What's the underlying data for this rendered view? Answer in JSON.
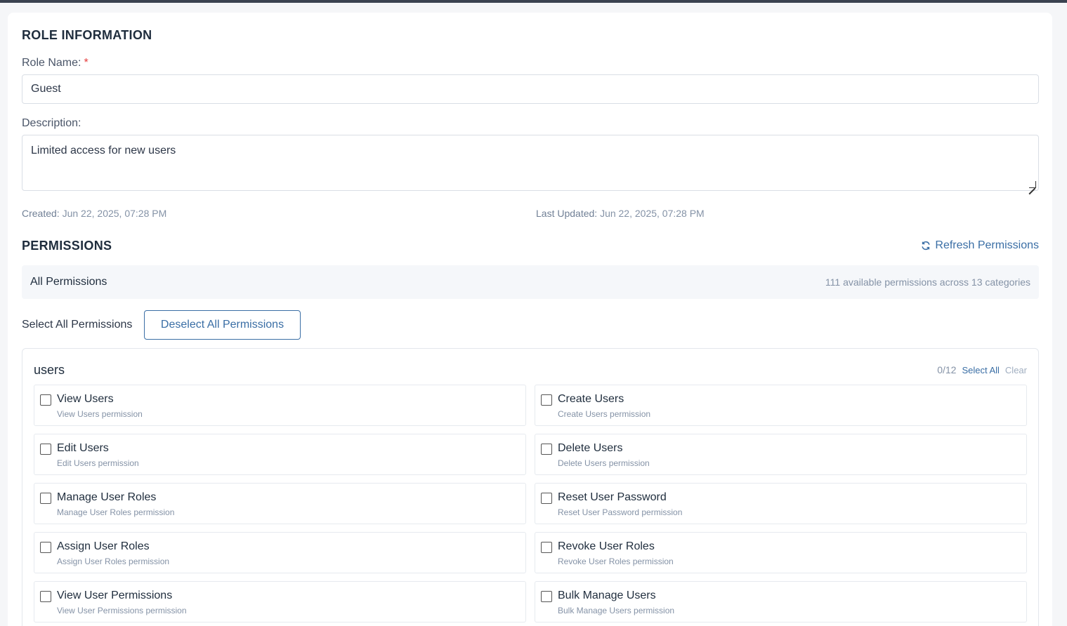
{
  "role_info": {
    "title": "ROLE INFORMATION",
    "name_label": "Role Name:",
    "required_mark": "*",
    "name_value": "Guest",
    "description_label": "Description:",
    "description_value": "Limited access for new users",
    "created_label": "Created:",
    "created_value": "Jun 22, 2025, 07:28 PM",
    "updated_label": "Last Updated:",
    "updated_value": "Jun 22, 2025, 07:28 PM"
  },
  "permissions": {
    "title": "PERMISSIONS",
    "refresh_label": "Refresh Permissions",
    "all_label": "All Permissions",
    "summary": "111 available permissions across 13 categories",
    "select_all_label": "Select All Permissions",
    "deselect_all_label": "Deselect All Permissions",
    "group": {
      "name": "users",
      "count": "0/12",
      "select_all": "Select All",
      "clear": "Clear",
      "items": [
        {
          "name": "View Users",
          "desc": "View Users permission"
        },
        {
          "name": "Create Users",
          "desc": "Create Users permission"
        },
        {
          "name": "Edit Users",
          "desc": "Edit Users permission"
        },
        {
          "name": "Delete Users",
          "desc": "Delete Users permission"
        },
        {
          "name": "Manage User Roles",
          "desc": "Manage User Roles permission"
        },
        {
          "name": "Reset User Password",
          "desc": "Reset User Password permission"
        },
        {
          "name": "Assign User Roles",
          "desc": "Assign User Roles permission"
        },
        {
          "name": "Revoke User Roles",
          "desc": "Revoke User Roles permission"
        },
        {
          "name": "View User Permissions",
          "desc": "View User Permissions permission"
        },
        {
          "name": "Bulk Manage Users",
          "desc": "Bulk Manage Users permission"
        }
      ]
    }
  },
  "colors": {
    "accent": "#3a6ea5",
    "required": "#e53e3e",
    "topbar": "#3a4250"
  }
}
